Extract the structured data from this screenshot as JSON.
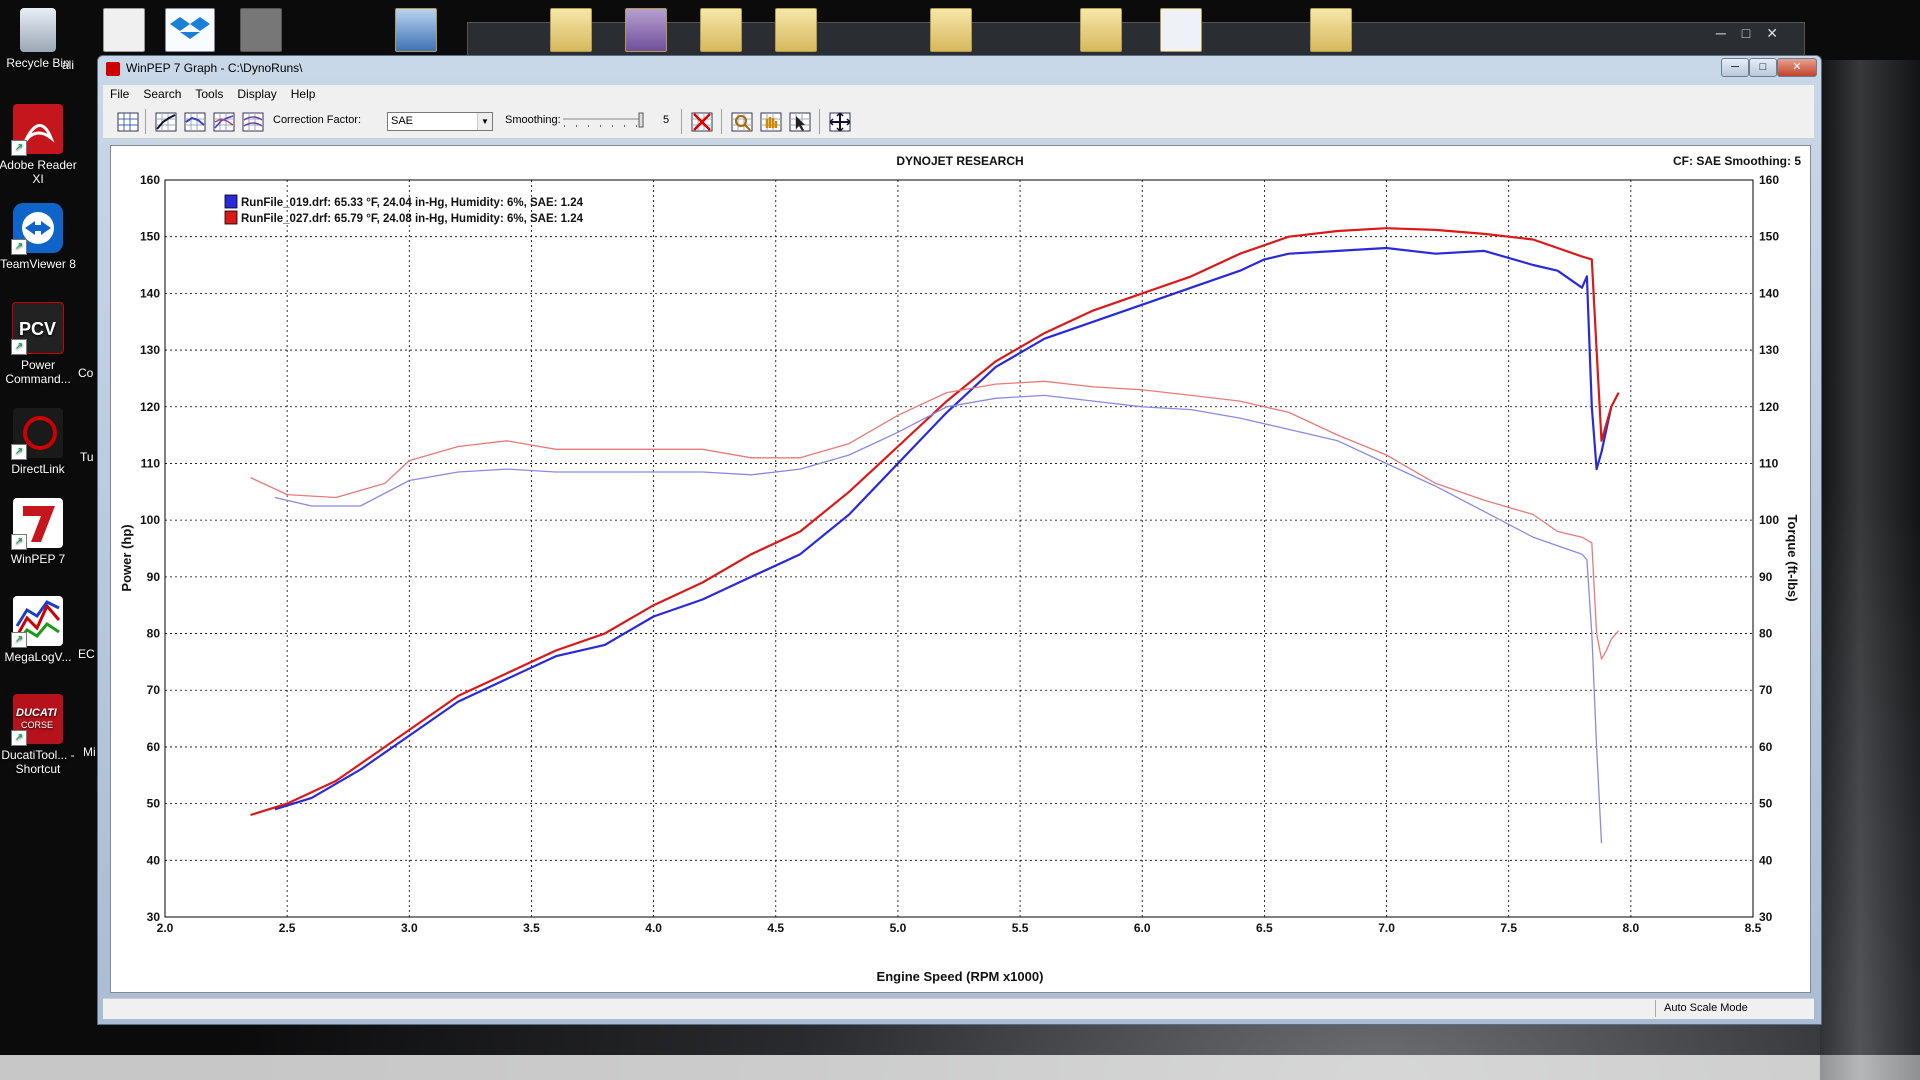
{
  "desktop": {
    "icons": [
      {
        "label": "Recycle Bin",
        "icon": "recycle-bin-icon"
      },
      {
        "label": "Adobe Reader XI",
        "icon": "adobe-reader-icon"
      },
      {
        "label": "TeamViewer 8",
        "icon": "teamviewer-icon"
      },
      {
        "label": "Power Command...",
        "icon": "power-commander-icon"
      },
      {
        "label": "DirectLink",
        "icon": "directlink-icon"
      },
      {
        "label": "WinPEP 7",
        "icon": "winpep-icon"
      },
      {
        "label": "MegaLogV...",
        "icon": "megalogviewer-icon"
      },
      {
        "label": "DucatiTool... - Shortcut",
        "icon": "ducati-icon"
      }
    ],
    "partial_labels": [
      "ali",
      "Co",
      "Tu",
      "EC",
      "Mi"
    ]
  },
  "window": {
    "title": "WinPEP 7    Graph - C:\\DynoRuns\\",
    "controls": {
      "minimize": "─",
      "maximize": "□",
      "close": "✕"
    }
  },
  "menu": [
    "File",
    "Search",
    "Tools",
    "Display",
    "Help"
  ],
  "toolbar": {
    "correction_factor_label": "Correction Factor:",
    "correction_factor_value": "SAE",
    "smoothing_label": "Smoothing:",
    "smoothing_value": "5"
  },
  "status_bar": {
    "mode": "Auto Scale Mode"
  },
  "colors": {
    "series_blue": "#2a2ad8",
    "series_red": "#d81a1a",
    "series_red_light": "#e77a7a",
    "series_blue_light": "#8a8ae0"
  },
  "chart_data": {
    "type": "line",
    "title": "DYNOJET RESEARCH",
    "subtitle": "CF: SAE   Smoothing: 5",
    "xlabel": "Engine Speed (RPM x1000)",
    "ylabel": "Power (hp)",
    "y2label": "Torque (ft-lbs)",
    "xlim": [
      2.0,
      8.5
    ],
    "ylim": [
      30,
      160
    ],
    "y2lim": [
      30,
      160
    ],
    "xticks": [
      "2.0",
      "2.5",
      "3.0",
      "3.5",
      "4.0",
      "4.5",
      "5.0",
      "5.5",
      "6.0",
      "6.5",
      "7.0",
      "7.5",
      "8.0",
      "8.5"
    ],
    "yticks": [
      "30",
      "40",
      "50",
      "60",
      "70",
      "80",
      "90",
      "100",
      "110",
      "120",
      "130",
      "140",
      "150",
      "160"
    ],
    "grid": true,
    "legend_position": "top-left",
    "legend": [
      {
        "name": "RunFile_019.drf: 65.33 °F, 24.04 in-Hg, Humidity: 6%, SAE: 1.24",
        "color": "#2a2ad8"
      },
      {
        "name": "RunFile_027.drf: 65.79 °F, 24.08 in-Hg, Humidity: 6%, SAE: 1.24",
        "color": "#d81a1a"
      }
    ],
    "series": [
      {
        "name": "RunFile_019.drf",
        "measure": "power",
        "color": "#2a2ad8",
        "x": [
          2.45,
          2.6,
          2.8,
          3.0,
          3.2,
          3.4,
          3.6,
          3.8,
          4.0,
          4.2,
          4.4,
          4.6,
          4.8,
          5.0,
          5.2,
          5.4,
          5.6,
          5.8,
          6.0,
          6.2,
          6.4,
          6.5,
          6.6,
          6.8,
          7.0,
          7.2,
          7.4,
          7.6,
          7.7,
          7.8,
          7.82,
          7.84,
          7.86,
          7.88,
          7.9,
          7.92
        ],
        "y": [
          49,
          51,
          56,
          62,
          68,
          72,
          76,
          78,
          83,
          86,
          90,
          94,
          101,
          110,
          119,
          127,
          132,
          135,
          138,
          141,
          144,
          146,
          147,
          147.5,
          148,
          147,
          147.5,
          145,
          144,
          141,
          143,
          120,
          109,
          112,
          116,
          120
        ]
      },
      {
        "name": "RunFile_027.drf",
        "measure": "power",
        "color": "#d81a1a",
        "x": [
          2.35,
          2.5,
          2.7,
          2.9,
          3.0,
          3.2,
          3.4,
          3.6,
          3.8,
          4.0,
          4.2,
          4.4,
          4.6,
          4.8,
          5.0,
          5.2,
          5.4,
          5.6,
          5.8,
          6.0,
          6.2,
          6.4,
          6.6,
          6.8,
          7.0,
          7.2,
          7.4,
          7.6,
          7.7,
          7.8,
          7.84,
          7.86,
          7.88,
          7.9,
          7.92,
          7.95
        ],
        "y": [
          48,
          50,
          54,
          60,
          63,
          69,
          73,
          77,
          80,
          85,
          89,
          94,
          98,
          105,
          113,
          121,
          128,
          133,
          137,
          140,
          143,
          147,
          150,
          151,
          151.5,
          151.2,
          150.5,
          149.5,
          148,
          146.5,
          146,
          130,
          114,
          117,
          120,
          122.5
        ]
      },
      {
        "name": "RunFile_019.drf",
        "measure": "torque",
        "color": "#8a8ae0",
        "x": [
          2.45,
          2.6,
          2.8,
          3.0,
          3.2,
          3.4,
          3.6,
          3.8,
          4.0,
          4.2,
          4.4,
          4.6,
          4.8,
          5.0,
          5.2,
          5.4,
          5.6,
          5.8,
          6.0,
          6.2,
          6.4,
          6.6,
          6.8,
          7.0,
          7.2,
          7.4,
          7.6,
          7.7,
          7.8,
          7.82,
          7.84,
          7.86,
          7.88
        ],
        "y": [
          104,
          102.5,
          102.5,
          107,
          108.5,
          109,
          108.5,
          108.5,
          108.5,
          108.5,
          108,
          109,
          111.5,
          115.5,
          120,
          121.5,
          122,
          121,
          120,
          119.5,
          118,
          116,
          114,
          110,
          106,
          101.5,
          97,
          95.5,
          94,
          93,
          80,
          60,
          43
        ]
      },
      {
        "name": "RunFile_027.drf",
        "measure": "torque",
        "color": "#e77a7a",
        "x": [
          2.35,
          2.5,
          2.7,
          2.9,
          3.0,
          3.2,
          3.4,
          3.6,
          3.8,
          4.0,
          4.2,
          4.4,
          4.6,
          4.8,
          5.0,
          5.2,
          5.4,
          5.6,
          5.8,
          6.0,
          6.2,
          6.4,
          6.6,
          6.8,
          7.0,
          7.2,
          7.4,
          7.6,
          7.7,
          7.8,
          7.84,
          7.86,
          7.88,
          7.9,
          7.92,
          7.95
        ],
        "y": [
          107.5,
          104.5,
          104,
          106.5,
          110.5,
          113,
          114,
          112.5,
          112.5,
          112.5,
          112.5,
          111,
          111,
          113.5,
          118.5,
          122.5,
          124,
          124.5,
          123.5,
          123,
          122,
          121,
          119,
          115,
          111.5,
          106.5,
          103.5,
          101,
          98,
          97,
          96,
          80,
          75.5,
          77,
          79,
          80.5
        ]
      }
    ]
  }
}
